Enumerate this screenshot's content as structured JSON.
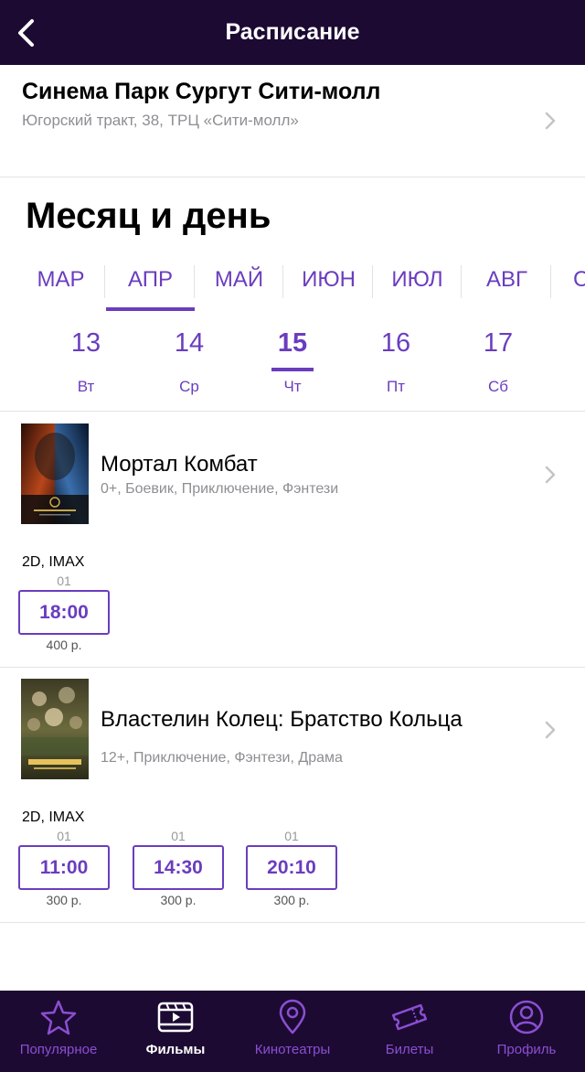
{
  "header": {
    "title": "Расписание",
    "back_icon": "chevron-left-icon"
  },
  "cinema": {
    "name": "Синема Парк Сургут Сити-молл",
    "address": "Югорский тракт, 38, ТРЦ «Сити-молл»"
  },
  "section": {
    "title": "Месяц и день"
  },
  "months": [
    {
      "label": "МАР",
      "selected": false
    },
    {
      "label": "АПР",
      "selected": true
    },
    {
      "label": "МАЙ",
      "selected": false
    },
    {
      "label": "ИЮН",
      "selected": false
    },
    {
      "label": "ИЮЛ",
      "selected": false
    },
    {
      "label": "АВГ",
      "selected": false
    },
    {
      "label": "С",
      "selected": false
    }
  ],
  "days": [
    {
      "num": "13",
      "dow": "Вт",
      "selected": false
    },
    {
      "num": "14",
      "dow": "Ср",
      "selected": false
    },
    {
      "num": "15",
      "dow": "Чт",
      "selected": true
    },
    {
      "num": "16",
      "dow": "Пт",
      "selected": false
    },
    {
      "num": "17",
      "dow": "Сб",
      "selected": false
    }
  ],
  "movies": [
    {
      "title": "Мортал Комбат",
      "meta": "0+, Боевик, Приключение, Фэнтези",
      "format": "2D, IMAX",
      "sessions": [
        {
          "hall": "01",
          "time": "18:00",
          "price": "400 р."
        }
      ]
    },
    {
      "title": "Властелин Колец: Братство Кольца",
      "meta": "12+, Приключение, Фэнтези, Драма",
      "format": "2D, IMAX",
      "sessions": [
        {
          "hall": "01",
          "time": "11:00",
          "price": "300 р."
        },
        {
          "hall": "01",
          "time": "14:30",
          "price": "300 р."
        },
        {
          "hall": "01",
          "time": "20:10",
          "price": "300 р."
        }
      ]
    }
  ],
  "tabbar": {
    "items": [
      {
        "label": "Популярное",
        "icon": "star-icon",
        "active": false
      },
      {
        "label": "Фильмы",
        "icon": "film-icon",
        "active": true
      },
      {
        "label": "Кинотеатры",
        "icon": "map-pin-icon",
        "active": false
      },
      {
        "label": "Билеты",
        "icon": "ticket-icon",
        "active": false
      },
      {
        "label": "Профиль",
        "icon": "profile-icon",
        "active": false
      }
    ]
  },
  "colors": {
    "header_bg": "#1c0a33",
    "accent": "#6a3dbf",
    "muted": "#8e8e93"
  }
}
